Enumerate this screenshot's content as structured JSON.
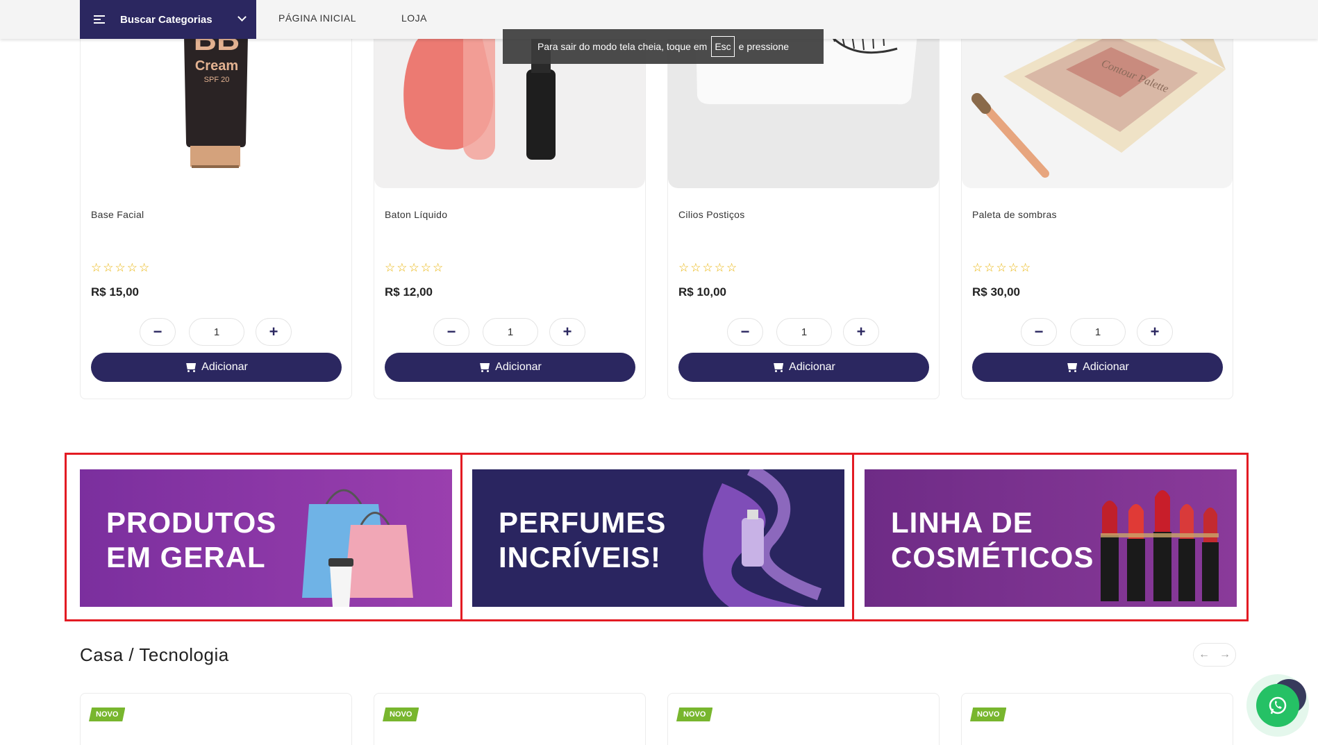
{
  "nav": {
    "categories_label": "Buscar Categorias",
    "links": [
      "PÁGINA INICIAL",
      "LOJA"
    ]
  },
  "fullscreen_toast": {
    "before": "Para sair do modo tela cheia, toque em",
    "key": "Esc",
    "after": "e pressione"
  },
  "products": [
    {
      "name": "Base Facial",
      "price": "R$ 15,00",
      "rating": 0,
      "qty": "1",
      "add_label": "Adicionar"
    },
    {
      "name": "Baton Líquido",
      "price": "R$ 12,00",
      "rating": 0,
      "qty": "1",
      "add_label": "Adicionar"
    },
    {
      "name": "Cilios Postiços",
      "price": "R$ 10,00",
      "rating": 0,
      "qty": "1",
      "add_label": "Adicionar"
    },
    {
      "name": "Paleta de sombras",
      "price": "R$ 30,00",
      "rating": 0,
      "qty": "1",
      "add_label": "Adicionar"
    }
  ],
  "product_image_text": {
    "bb_line1": "BB",
    "bb_line2": "Cream",
    "bb_line3": "SPF 20",
    "palette": "Contour Palette"
  },
  "qty_controls": {
    "minus": "−",
    "plus": "+"
  },
  "banners": [
    {
      "line1": "PRODUTOS",
      "line2": "EM GERAL",
      "bg": "#7b2f9e"
    },
    {
      "line1": "PERFUMES",
      "line2": "INCRÍVEIS!",
      "bg": "#2a2560"
    },
    {
      "line1": "LINHA DE",
      "line2": "COSMÉTICOS",
      "bg": "#6e2b86"
    }
  ],
  "section": {
    "title": "Casa / Tecnologia",
    "prev": "←",
    "next": "→"
  },
  "new_badges": [
    "NOVO",
    "NOVO",
    "NOVO",
    "NOVO"
  ],
  "colors": {
    "primary": "#2b2760",
    "star": "#e8b100",
    "badge": "#78b62e",
    "whatsapp": "#25c165",
    "highlight": "#e31b23"
  },
  "icons": [
    "menu-icon",
    "chevron-down-icon",
    "cart-icon",
    "whatsapp-icon",
    "arrow-left-icon",
    "arrow-right-icon",
    "star-icon"
  ]
}
